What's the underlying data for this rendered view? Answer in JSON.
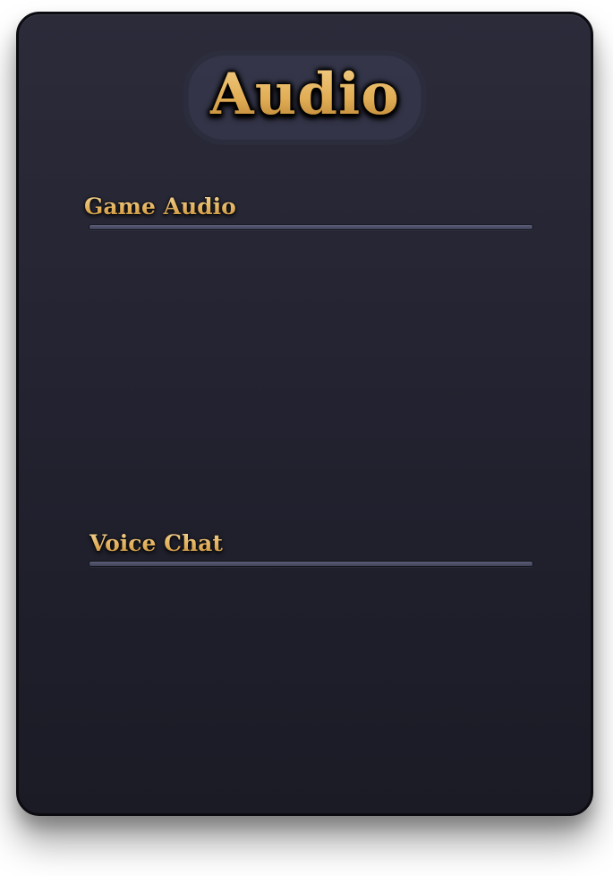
{
  "screen": {
    "title": "Audio"
  },
  "sections": [
    {
      "title": "Game Audio"
    },
    {
      "title": "Voice Chat"
    }
  ],
  "colors": {
    "panel_top": "#2b2b3a",
    "panel_bottom": "#1b1b26",
    "gold_text": "#e2b560",
    "divider": "#4a4b63"
  }
}
